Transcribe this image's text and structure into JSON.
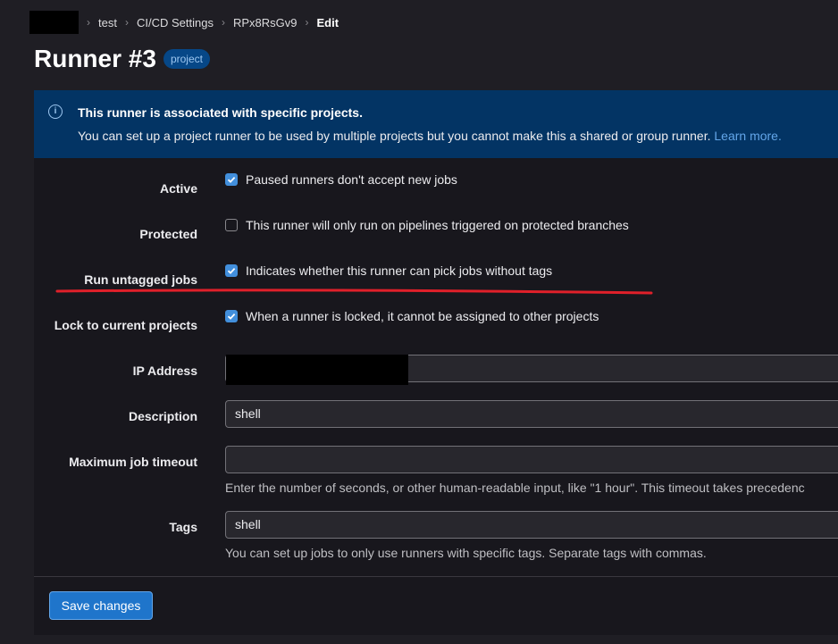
{
  "breadcrumb": {
    "items": [
      "test",
      "CI/CD Settings",
      "RPx8RsGv9"
    ],
    "current": "Edit"
  },
  "page": {
    "title": "Runner #3",
    "badge": "project"
  },
  "alert": {
    "title": "This runner is associated with specific projects.",
    "body": "You can set up a project runner to be used by multiple projects but you cannot make this a shared or group runner.",
    "link": "Learn more."
  },
  "form": {
    "active": {
      "label": "Active",
      "text": "Paused runners don't accept new jobs",
      "checked": true
    },
    "protected": {
      "label": "Protected",
      "text": "This runner will only run on pipelines triggered on protected branches",
      "checked": false
    },
    "run_untagged": {
      "label": "Run untagged jobs",
      "text": "Indicates whether this runner can pick jobs without tags",
      "checked": true
    },
    "locked": {
      "label": "Lock to current projects",
      "text": "When a runner is locked, it cannot be assigned to other projects",
      "checked": true
    },
    "ip_address": {
      "label": "IP Address",
      "value": ""
    },
    "description": {
      "label": "Description",
      "value": "shell"
    },
    "timeout": {
      "label": "Maximum job timeout",
      "value": "",
      "help": "Enter the number of seconds, or other human-readable input, like \"1 hour\". This timeout takes precedenc"
    },
    "tags": {
      "label": "Tags",
      "value": "shell",
      "help": "You can set up jobs to only use runners with specific tags. Separate tags with commas."
    }
  },
  "actions": {
    "save_label": "Save changes"
  },
  "colors": {
    "accent": "#428fdc",
    "annotation": "#e0202a",
    "alert_bg": "#033464"
  }
}
